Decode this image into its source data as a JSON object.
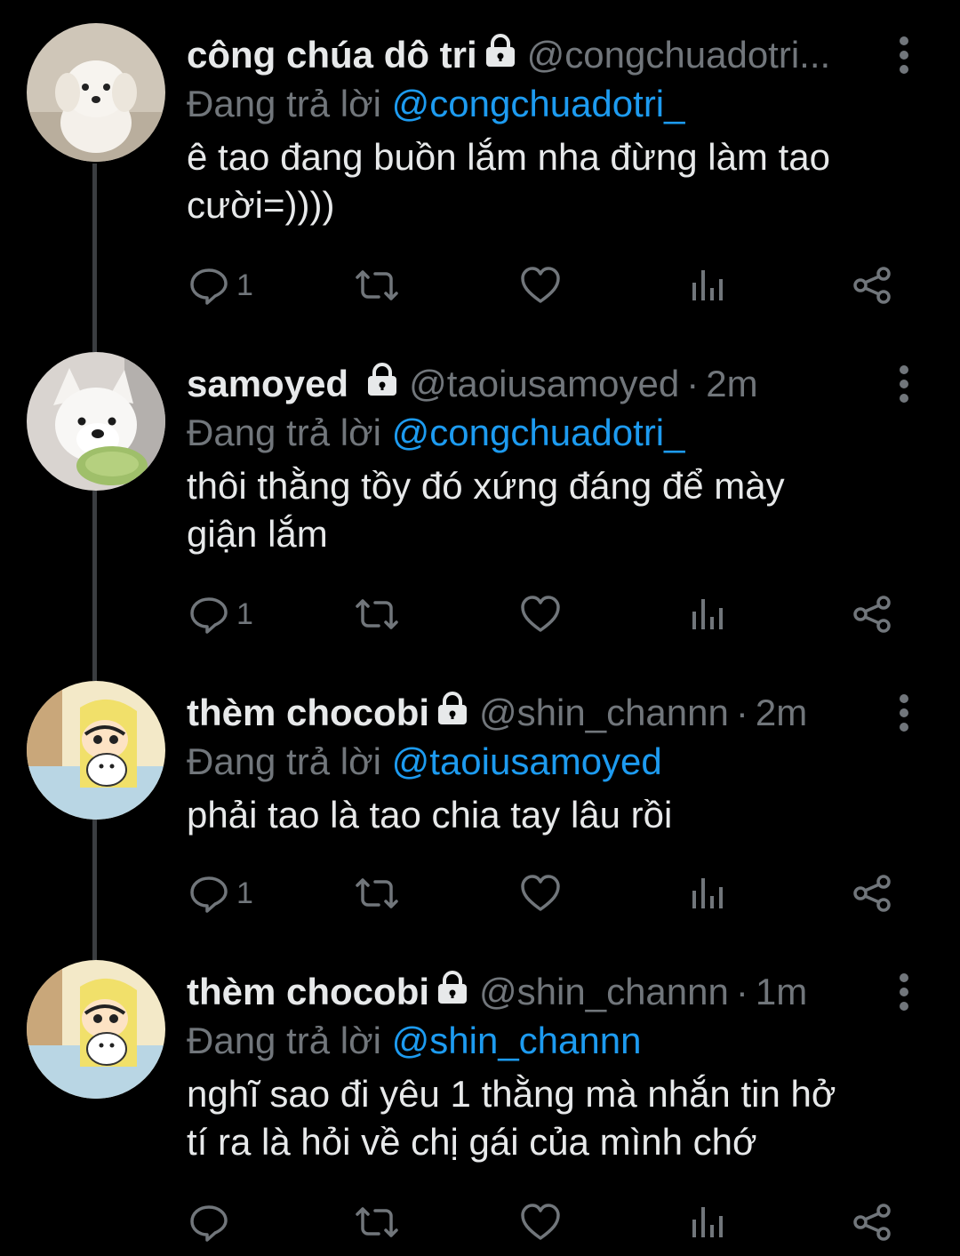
{
  "tweets": [
    {
      "name": "công chúa dô tri",
      "handle": "@congchuadotri...",
      "dot": "",
      "time": "",
      "reply_prefix": "Đang trả lời",
      "reply_handle": "@congchuadotri_",
      "text_lines": [
        "ê tao đang buồn lắm nha đừng làm tao",
        "cười=))))"
      ],
      "reply_count": "1",
      "avatar": "white-puppy-avatar"
    },
    {
      "name": "samoyed",
      "handle": "@taoiusamoyed",
      "dot": "·",
      "time": "2m",
      "reply_prefix": "Đang trả lời",
      "reply_handle": "@congchuadotri_",
      "text_lines": [
        "thôi thằng tồy đó xứng đáng để mày",
        "giận lắm"
      ],
      "reply_count": "1",
      "avatar": "samoyed-dog-avatar"
    },
    {
      "name": "thèm chocobi",
      "handle": "@shin_channn",
      "dot": "·",
      "time": "2m",
      "reply_prefix": "Đang trả lời",
      "reply_handle": "@taoiusamoyed",
      "text_lines": [
        "phải tao là tao chia tay lâu rồi"
      ],
      "reply_count": "1",
      "avatar": "shin-chan-cartoon-avatar"
    },
    {
      "name": "thèm chocobi",
      "handle": "@shin_channn",
      "dot": "·",
      "time": "1m",
      "reply_prefix": "Đang trả lời",
      "reply_handle": "@shin_channn",
      "text_lines": [
        "nghĩ sao đi yêu 1 thằng mà nhắn tin hở",
        "tí ra là hỏi về chị gái của mình chớ"
      ],
      "reply_count": "",
      "avatar": "shin-chan-cartoon-avatar"
    }
  ],
  "icons": {
    "lock": "lock-icon",
    "more": "more-vertical-icon",
    "reply": "reply-bubble-icon",
    "retweet": "retweet-icon",
    "like": "heart-icon",
    "views": "views-chart-icon",
    "share": "share-icon"
  },
  "colors": {
    "background": "#000000",
    "text": "#e7e9ea",
    "muted": "#71767b",
    "link": "#1d9bf0",
    "thread_line": "#3a3d40"
  }
}
